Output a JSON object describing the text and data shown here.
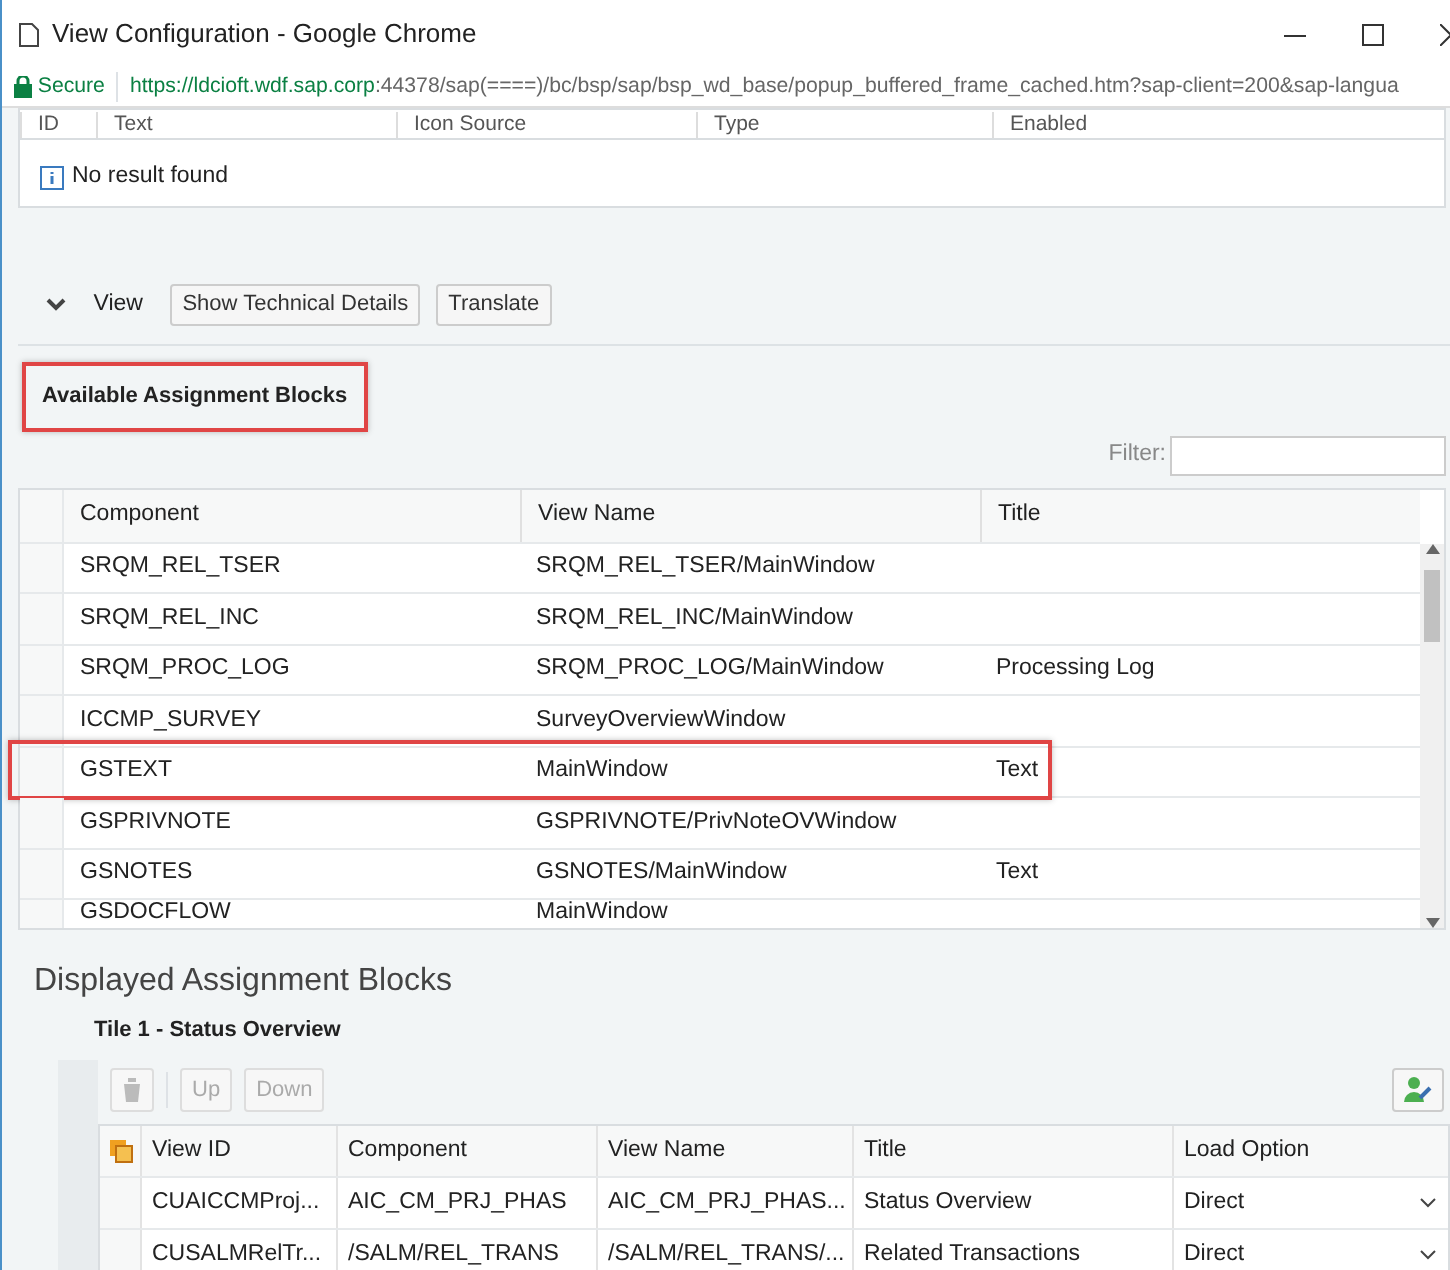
{
  "window": {
    "title": "View Configuration - Google Chrome"
  },
  "address_bar": {
    "security": "Secure",
    "url_host": "https://ldcioft.wdf.sap.corp",
    "url_rest": ":44378/sap(====)/bc/bsp/sap/bsp_wd_base/popup_buffered_frame_cached.htm?sap-client=200&sap-langua"
  },
  "top_table": {
    "columns": [
      "ID",
      "Text",
      "Icon Source",
      "Type",
      "Enabled"
    ],
    "message": "No result found"
  },
  "view_bar": {
    "label": "View",
    "expanded": true,
    "buttons": [
      "Show Technical Details",
      "Translate"
    ]
  },
  "available": {
    "title": "Available Assignment Blocks",
    "highlighted": true,
    "filter_label": "Filter:",
    "columns": [
      "Component",
      "View Name",
      "Title"
    ],
    "rows": [
      {
        "component": "SRQM_REL_TSER",
        "view_name": "SRQM_REL_TSER/MainWindow",
        "title": "",
        "highlighted": false
      },
      {
        "component": "SRQM_REL_INC",
        "view_name": "SRQM_REL_INC/MainWindow",
        "title": "",
        "highlighted": false
      },
      {
        "component": "SRQM_PROC_LOG",
        "view_name": "SRQM_PROC_LOG/MainWindow",
        "title": "Processing Log",
        "highlighted": false
      },
      {
        "component": "ICCMP_SURVEY",
        "view_name": "SurveyOverviewWindow",
        "title": "",
        "highlighted": false
      },
      {
        "component": "GSTEXT",
        "view_name": "MainWindow",
        "title": "Text",
        "highlighted": true
      },
      {
        "component": "GSPRIVNOTE",
        "view_name": "GSPRIVNOTE/PrivNoteOVWindow",
        "title": "",
        "highlighted": false
      },
      {
        "component": "GSNOTES",
        "view_name": "GSNOTES/MainWindow",
        "title": "Text",
        "highlighted": false
      },
      {
        "component": "GSDOCFLOW",
        "view_name": "MainWindow",
        "title": "",
        "highlighted": false
      }
    ]
  },
  "displayed": {
    "title": "Displayed Assignment Blocks",
    "tile_title": "Tile 1 - Status Overview",
    "toolbar": [
      {
        "label": "Up",
        "disabled": true
      },
      {
        "label": "Down",
        "disabled": true
      }
    ],
    "columns": [
      "View ID",
      "Component",
      "View Name",
      "Title",
      "Load Option"
    ],
    "rows": [
      {
        "view_id": "CUAICCMProj...",
        "component": "AIC_CM_PRJ_PHAS",
        "view_name": "AIC_CM_PRJ_PHAS...",
        "title": "Status Overview",
        "load_option": "Direct"
      },
      {
        "view_id": "CUSALMRelTr...",
        "component": "/SALM/REL_TRANS",
        "view_name": "/SALM/REL_TRANS/...",
        "title": "Related Transactions",
        "load_option": "Direct"
      }
    ]
  }
}
